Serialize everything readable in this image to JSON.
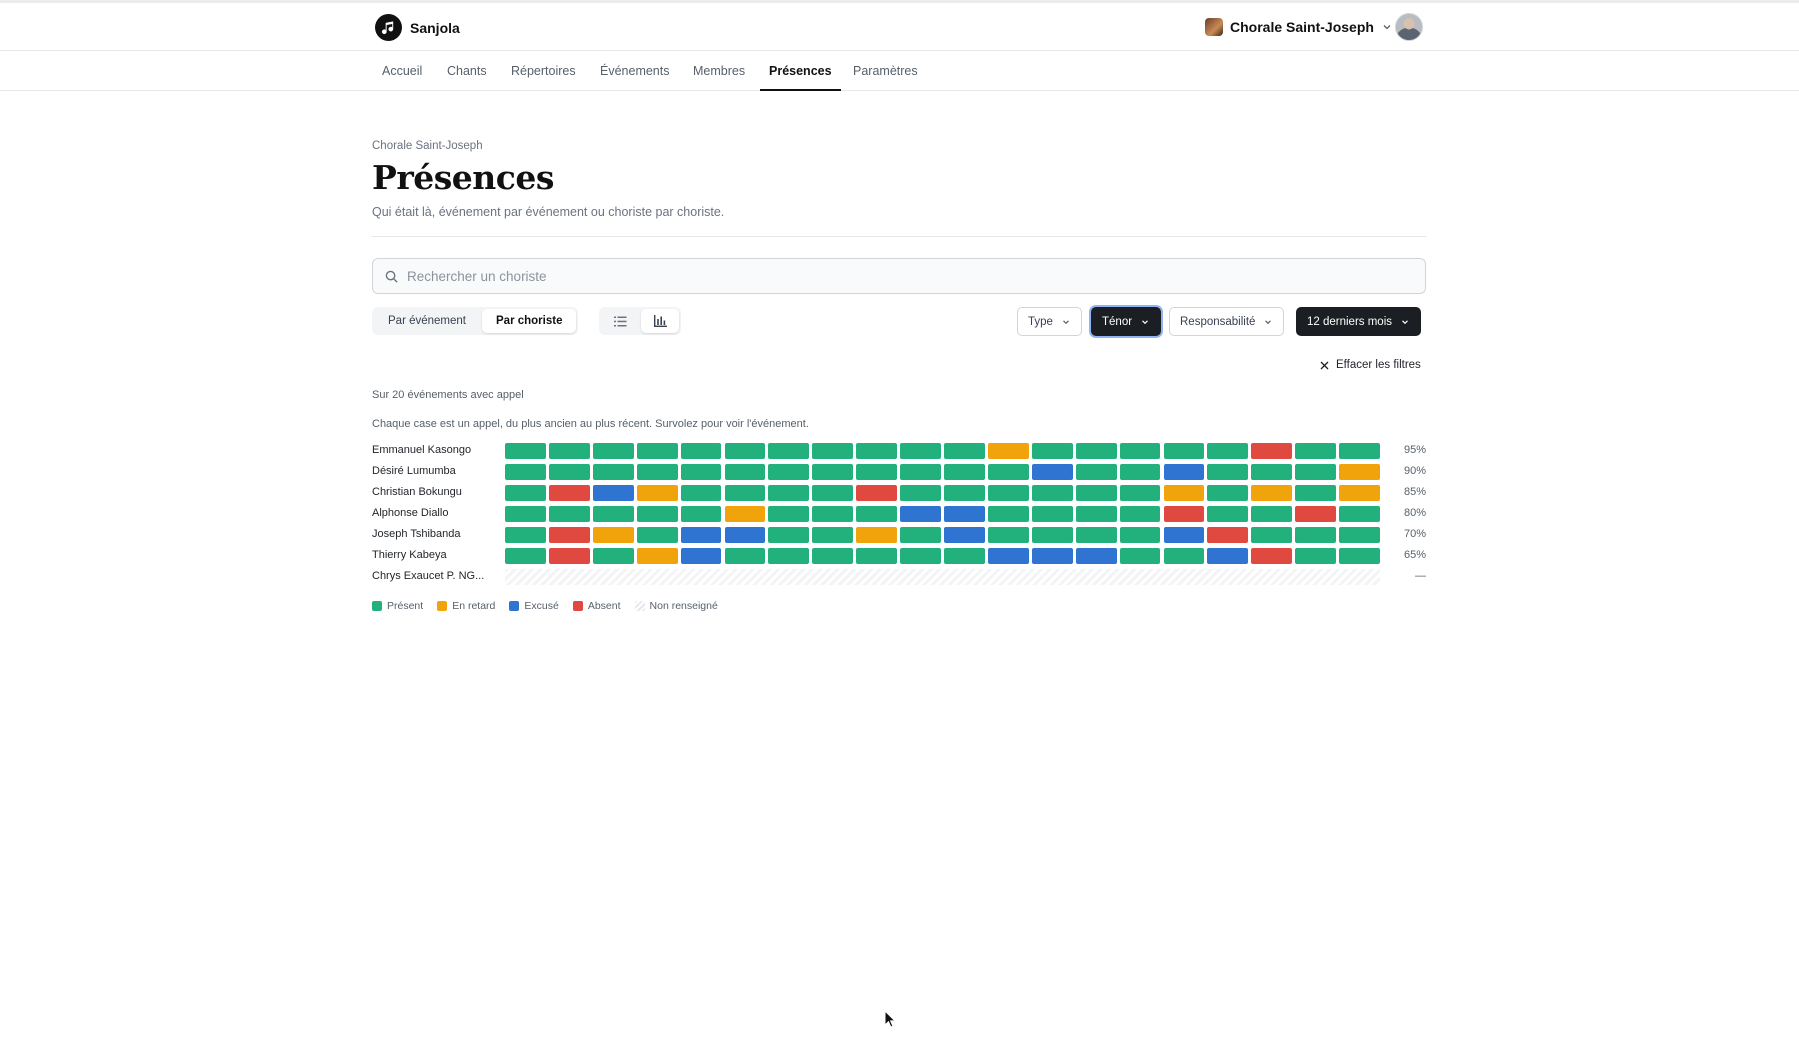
{
  "colors": {
    "present": "#22b07d",
    "late": "#f0a30a",
    "excused": "#2f74d0",
    "absent": "#e0493f",
    "unknown": "#eceef1",
    "dark": "#1b1f24"
  },
  "header": {
    "brand_name": "Sanjola",
    "org_name": "Chorale Saint-Joseph"
  },
  "nav": {
    "items": [
      {
        "label": "Accueil"
      },
      {
        "label": "Chants"
      },
      {
        "label": "Répertoires"
      },
      {
        "label": "Événements"
      },
      {
        "label": "Membres"
      },
      {
        "label": "Présences"
      },
      {
        "label": "Paramètres"
      }
    ],
    "active": "Présences"
  },
  "page": {
    "breadcrumb": "Chorale Saint-Joseph",
    "title": "Présences",
    "subtitle": "Qui était là, événement par événement ou choriste par choriste."
  },
  "search": {
    "placeholder": "Rechercher un choriste",
    "value": ""
  },
  "view_toggle": {
    "by_event": "Par événement",
    "by_member": "Par choriste",
    "selected": "Par choriste",
    "modes": [
      {
        "icon": "list-icon"
      },
      {
        "icon": "bar-chart-icon",
        "selected": true
      }
    ]
  },
  "filters": {
    "type": "Type",
    "voice": "Ténor",
    "responsibility": "Responsabilité",
    "period": "12 derniers mois"
  },
  "clear_filters": "Effacer les filtres",
  "summary": "Sur 20 événements avec appel",
  "help_text": "Chaque case est un appel, du plus ancien au plus récent. Survolez pour voir l'événement.",
  "members": [
    {
      "name": "Emmanuel Kasongo",
      "rate": "95%",
      "cells": [
        "P",
        "P",
        "P",
        "P",
        "P",
        "P",
        "P",
        "P",
        "P",
        "P",
        "P",
        "L",
        "P",
        "P",
        "P",
        "P",
        "P",
        "A",
        "P",
        "P"
      ]
    },
    {
      "name": "Désiré Lumumba",
      "rate": "90%",
      "cells": [
        "P",
        "P",
        "P",
        "P",
        "P",
        "P",
        "P",
        "P",
        "P",
        "P",
        "P",
        "P",
        "E",
        "P",
        "P",
        "E",
        "P",
        "P",
        "P",
        "L"
      ]
    },
    {
      "name": "Christian Bokungu",
      "rate": "85%",
      "cells": [
        "P",
        "A",
        "E",
        "L",
        "P",
        "P",
        "P",
        "P",
        "A",
        "P",
        "P",
        "P",
        "P",
        "P",
        "P",
        "L",
        "P",
        "L",
        "P",
        "L"
      ]
    },
    {
      "name": "Alphonse Diallo",
      "rate": "80%",
      "cells": [
        "P",
        "P",
        "P",
        "P",
        "P",
        "L",
        "P",
        "P",
        "P",
        "E",
        "E",
        "P",
        "P",
        "P",
        "P",
        "A",
        "P",
        "P",
        "A",
        "P"
      ]
    },
    {
      "name": "Joseph Tshibanda",
      "rate": "70%",
      "cells": [
        "P",
        "A",
        "L",
        "P",
        "E",
        "E",
        "P",
        "P",
        "L",
        "P",
        "E",
        "P",
        "P",
        "P",
        "P",
        "E",
        "A",
        "P",
        "P",
        "P"
      ]
    },
    {
      "name": "Thierry Kabeya",
      "rate": "65%",
      "cells": [
        "P",
        "A",
        "P",
        "L",
        "E",
        "P",
        "P",
        "P",
        "P",
        "P",
        "P",
        "E",
        "E",
        "E",
        "P",
        "P",
        "E",
        "A",
        "P",
        "P"
      ]
    },
    {
      "name": "Chrys Exaucet P. NG...",
      "rate": "—",
      "cells": []
    }
  ],
  "legend": {
    "present": "Présent",
    "late": "En retard",
    "excused": "Excusé",
    "absent": "Absent",
    "unknown": "Non renseigné"
  }
}
